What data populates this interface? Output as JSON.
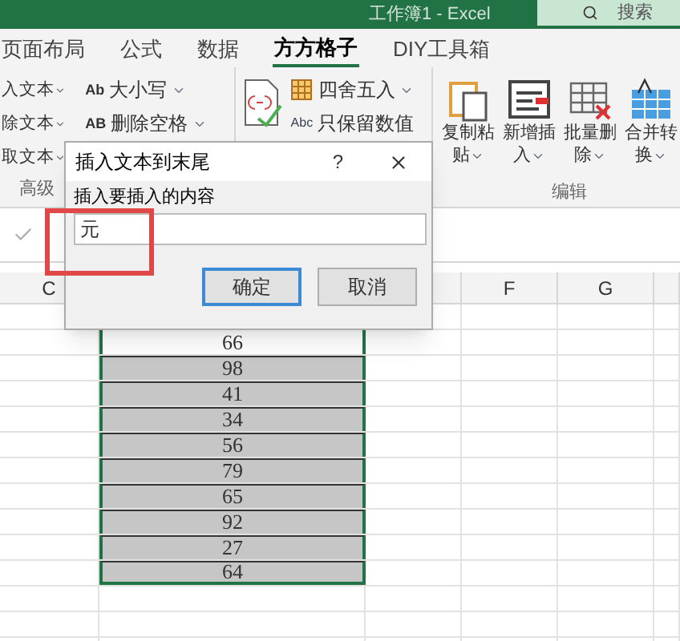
{
  "title_bar": {
    "title": "工作簿1 - Excel",
    "search_placeholder": "搜索"
  },
  "tabs": [
    {
      "label": "页面布局",
      "selected": false
    },
    {
      "label": "公式",
      "selected": false
    },
    {
      "label": "数据",
      "selected": false
    },
    {
      "label": "方方格子",
      "selected": true
    },
    {
      "label": "DIY工具箱",
      "selected": false
    }
  ],
  "ribbon": {
    "text_group": {
      "items": [
        "入文本",
        "除文本",
        "取文本"
      ],
      "label": "高级"
    },
    "case_items": [
      {
        "icon_text": "Ab",
        "label": "大小写"
      },
      {
        "icon_text": "AB",
        "label": "删除空格"
      }
    ],
    "number_items": [
      {
        "kind": "grid",
        "label": "四舍五入"
      },
      {
        "kind": "text",
        "icon_text": "Abc",
        "label": "只保留数值"
      }
    ],
    "edit_group": {
      "label": "编辑",
      "buttons": [
        {
          "kind": "clipboard",
          "line1": "复制粘",
          "line2": "贴"
        },
        {
          "kind": "insert",
          "line1": "新增插",
          "line2": "入"
        },
        {
          "kind": "delete",
          "line1": "批量删",
          "line2": "除"
        },
        {
          "kind": "merge",
          "line1": "合并转",
          "line2": "换"
        }
      ]
    }
  },
  "columns": [
    {
      "label": "C"
    },
    {
      "label": "F"
    },
    {
      "label": "G"
    }
  ],
  "cells": [
    {
      "value": "66",
      "active": true
    },
    {
      "value": "98",
      "active": false
    },
    {
      "value": "41",
      "active": false
    },
    {
      "value": "34",
      "active": false
    },
    {
      "value": "56",
      "active": false
    },
    {
      "value": "79",
      "active": false
    },
    {
      "value": "65",
      "active": false
    },
    {
      "value": "92",
      "active": false
    },
    {
      "value": "27",
      "active": false
    },
    {
      "value": "64",
      "active": false
    }
  ],
  "dialog": {
    "title": "插入文本到末尾",
    "help": "?",
    "prompt": "插入要插入的内容",
    "value": "元",
    "ok": "确定",
    "cancel": "取消"
  }
}
